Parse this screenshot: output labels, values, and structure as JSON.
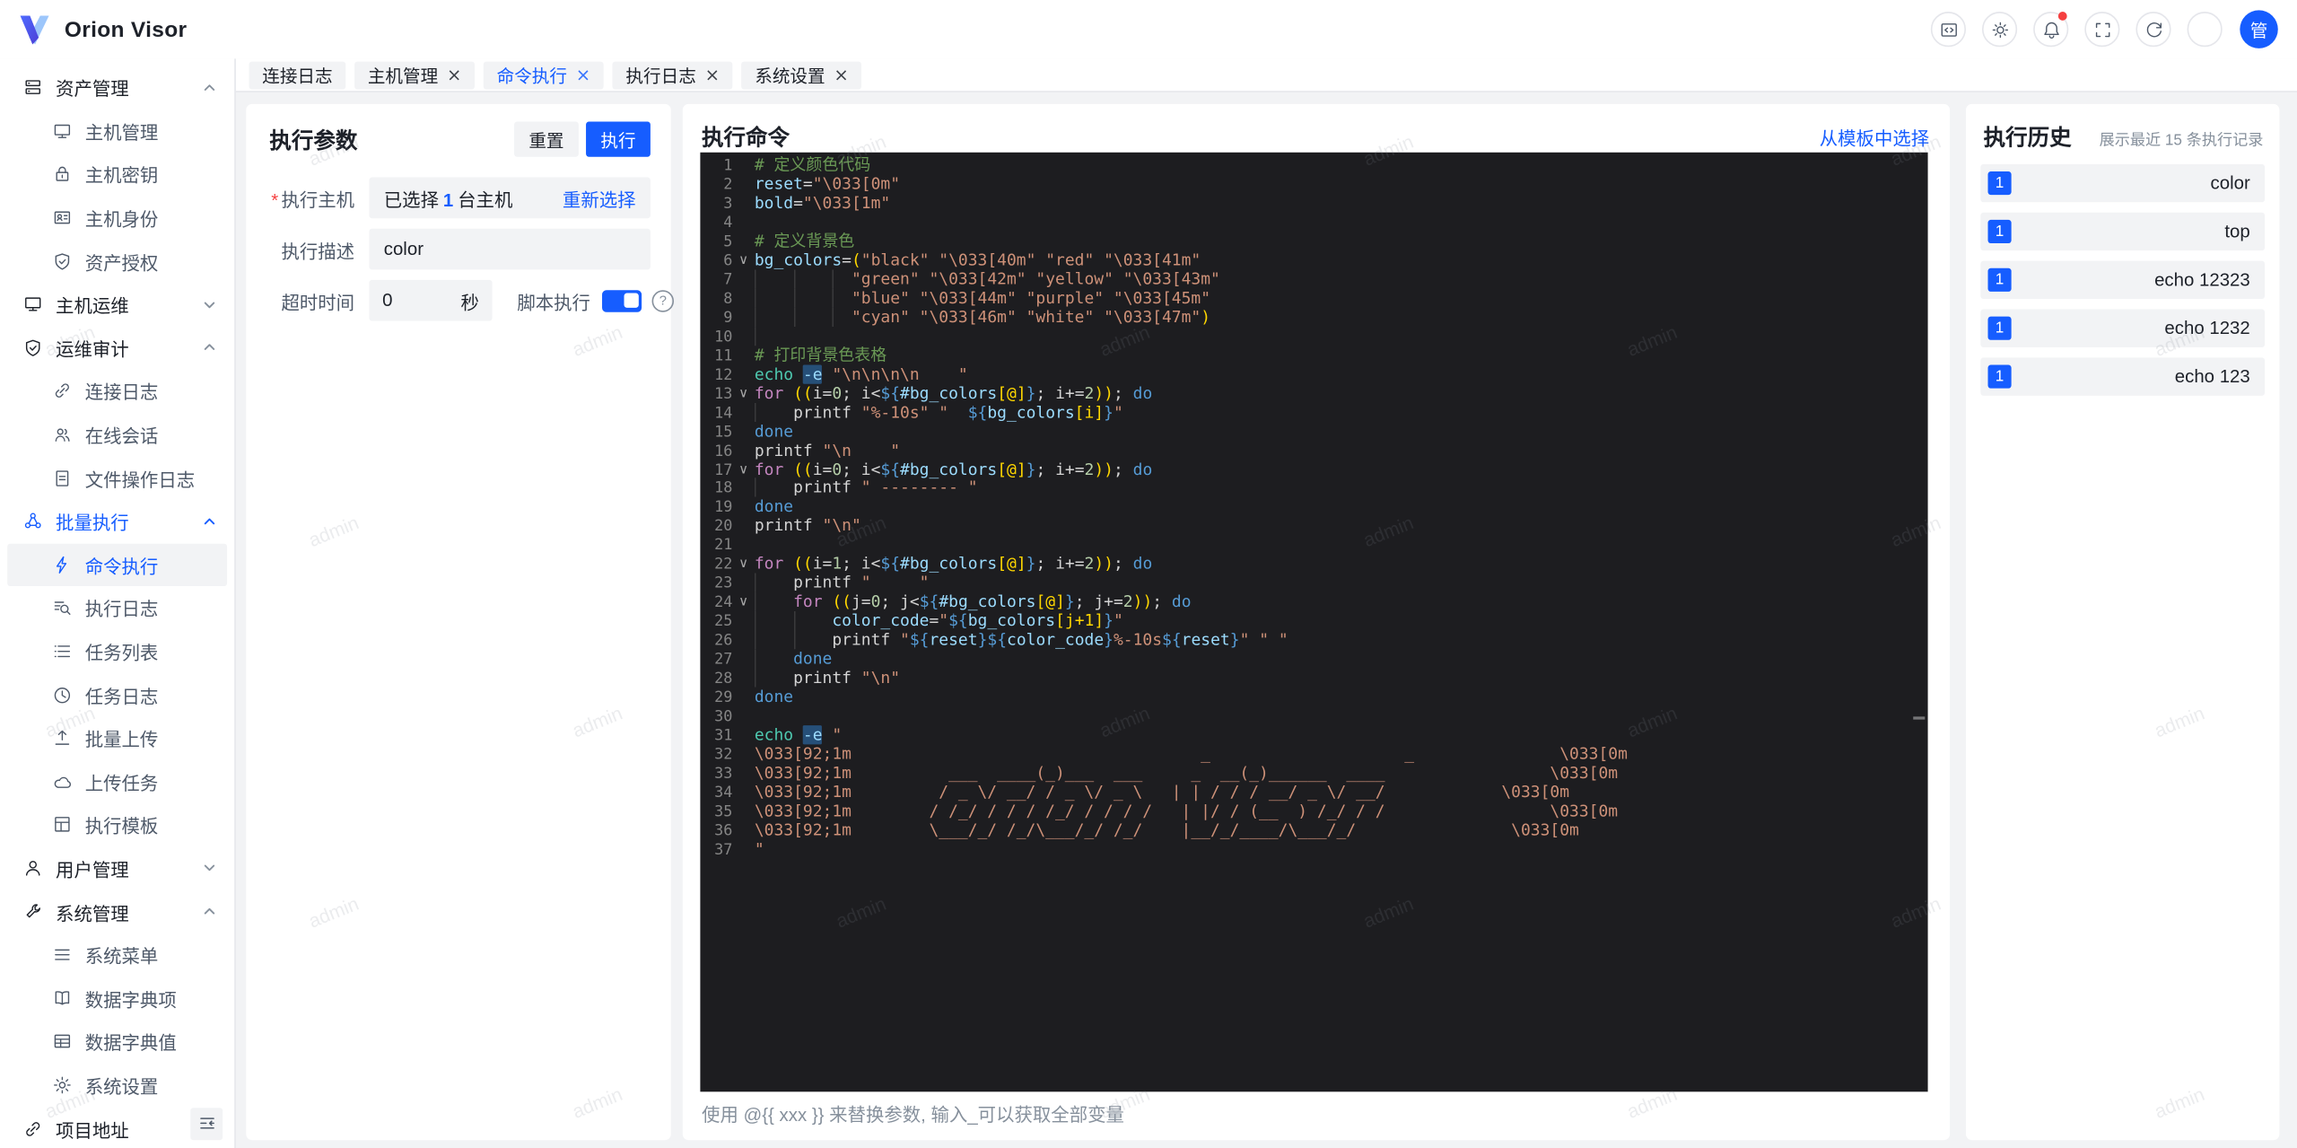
{
  "app": {
    "title": "Orion Visor",
    "avatar_text": "管"
  },
  "header": {
    "icons": [
      {
        "name": "code-window-icon"
      },
      {
        "name": "theme-icon"
      },
      {
        "name": "notification-icon",
        "dot": true
      },
      {
        "name": "fullscreen-icon"
      },
      {
        "name": "refresh-icon"
      },
      {
        "name": "settings-icon"
      }
    ]
  },
  "tabs": [
    {
      "label": "连接日志",
      "closable": false,
      "active": false
    },
    {
      "label": "主机管理",
      "closable": true,
      "active": false
    },
    {
      "label": "命令执行",
      "closable": true,
      "active": true
    },
    {
      "label": "执行日志",
      "closable": true,
      "active": false
    },
    {
      "label": "系统设置",
      "closable": true,
      "active": false
    }
  ],
  "sidebar": {
    "items": [
      {
        "label": "资产管理",
        "icon": "storage-icon",
        "lvl": 0,
        "chev": "up"
      },
      {
        "label": "主机管理",
        "icon": "desktop-icon",
        "lvl": 1
      },
      {
        "label": "主机密钥",
        "icon": "lock-icon",
        "lvl": 1
      },
      {
        "label": "主机身份",
        "icon": "idcard-icon",
        "lvl": 1
      },
      {
        "label": "资产授权",
        "icon": "safe-icon",
        "lvl": 1
      },
      {
        "label": "主机运维",
        "icon": "desktop-icon",
        "lvl": 0,
        "chev": "down"
      },
      {
        "label": "运维审计",
        "icon": "shield-icon",
        "lvl": 0,
        "chev": "up"
      },
      {
        "label": "连接日志",
        "icon": "link-icon",
        "lvl": 1
      },
      {
        "label": "在线会话",
        "icon": "users-icon",
        "lvl": 1
      },
      {
        "label": "文件操作日志",
        "icon": "file-icon",
        "lvl": 1
      },
      {
        "label": "批量执行",
        "icon": "cluster-icon",
        "lvl": 0,
        "chev": "up",
        "blue": true
      },
      {
        "label": "命令执行",
        "icon": "bolt-icon",
        "lvl": 1,
        "active": true
      },
      {
        "label": "执行日志",
        "icon": "search-list-icon",
        "lvl": 1
      },
      {
        "label": "任务列表",
        "icon": "list-icon",
        "lvl": 1
      },
      {
        "label": "任务日志",
        "icon": "clock-icon",
        "lvl": 1
      },
      {
        "label": "批量上传",
        "icon": "upload-icon",
        "lvl": 1
      },
      {
        "label": "上传任务",
        "icon": "cloud-icon",
        "lvl": 1
      },
      {
        "label": "执行模板",
        "icon": "template-icon",
        "lvl": 1
      },
      {
        "label": "用户管理",
        "icon": "user-icon",
        "lvl": 0,
        "chev": "down"
      },
      {
        "label": "系统管理",
        "icon": "wrench-icon",
        "lvl": 0,
        "chev": "up"
      },
      {
        "label": "系统菜单",
        "icon": "menu-icon",
        "lvl": 1
      },
      {
        "label": "数据字典项",
        "icon": "book-icon",
        "lvl": 1
      },
      {
        "label": "数据字典值",
        "icon": "table-icon",
        "lvl": 1
      },
      {
        "label": "系统设置",
        "icon": "gear-icon",
        "lvl": 1
      },
      {
        "label": "项目地址",
        "icon": "link-icon",
        "lvl": 0
      }
    ]
  },
  "params": {
    "title": "执行参数",
    "reset": "重置",
    "run": "执行",
    "host_label": "执行主机",
    "host_value_prefix": "已选择",
    "host_count": "1",
    "host_value_suffix": "台主机",
    "reselect": "重新选择",
    "desc_label": "执行描述",
    "desc_value": "color",
    "timeout_label": "超时时间",
    "timeout_value": "0",
    "timeout_unit": "秒",
    "script_label": "脚本执行",
    "script_on": true,
    "help": "?"
  },
  "command": {
    "title": "执行命令",
    "template_link": "从模板中选择",
    "hint": "使用 @{{ xxx }} 来替换参数, 输入_可以获取全部变量"
  },
  "history": {
    "title": "执行历史",
    "subtitle": "展示最近 15 条执行记录",
    "items": [
      {
        "badge": "1",
        "text": "color"
      },
      {
        "badge": "1",
        "text": "top"
      },
      {
        "badge": "1",
        "text": "echo 12323"
      },
      {
        "badge": "1",
        "text": "echo 1232"
      },
      {
        "badge": "1",
        "text": "echo 123"
      }
    ]
  },
  "watermark": {
    "text": "admin"
  },
  "colors": {
    "primary": "#165dff",
    "danger": "#f53f3f",
    "page_bg": "#f2f3f5",
    "border": "#e5e6eb",
    "text": "#1d2129",
    "text_secondary": "#4e5969",
    "text_tertiary": "#86909c",
    "editor_bg": "#1d1d20"
  },
  "editor": {
    "lines": [
      {
        "n": 1,
        "t": [
          [
            "cm",
            "# 定义颜色代码"
          ]
        ]
      },
      {
        "n": 2,
        "t": [
          [
            "vr",
            "reset"
          ],
          [
            "pl",
            "="
          ],
          [
            "st",
            "\"\\033[0m\""
          ]
        ]
      },
      {
        "n": 3,
        "t": [
          [
            "vr",
            "bold"
          ],
          [
            "pl",
            "="
          ],
          [
            "st",
            "\"\\033[1m\""
          ]
        ]
      },
      {
        "n": 4,
        "t": []
      },
      {
        "n": 5,
        "t": [
          [
            "cm",
            "# 定义背景色"
          ]
        ]
      },
      {
        "n": 6,
        "f": true,
        "t": [
          [
            "vr",
            "bg_colors"
          ],
          [
            "pl",
            "="
          ],
          [
            "br",
            "("
          ],
          [
            "st",
            "\"black\" \"\\033[40m\" \"red\" \"\\033[41m\""
          ]
        ]
      },
      {
        "n": 7,
        "t": [
          [
            "g",
            "    "
          ],
          [
            "g",
            "    "
          ],
          [
            "g",
            "  "
          ],
          [
            "st",
            "\"green\" \"\\033[42m\" \"yellow\" \"\\033[43m\""
          ]
        ]
      },
      {
        "n": 8,
        "t": [
          [
            "g",
            "    "
          ],
          [
            "g",
            "    "
          ],
          [
            "g",
            "  "
          ],
          [
            "st",
            "\"blue\" \"\\033[44m\" \"purple\" \"\\033[45m\""
          ]
        ]
      },
      {
        "n": 9,
        "t": [
          [
            "g",
            "    "
          ],
          [
            "g",
            "    "
          ],
          [
            "g",
            "  "
          ],
          [
            "st",
            "\"cyan\" \"\\033[46m\" \"white\" \"\\033[47m\""
          ],
          [
            "br",
            ")"
          ]
        ]
      },
      {
        "n": 10,
        "t": [
          [
            "g",
            "    "
          ]
        ]
      },
      {
        "n": 11,
        "t": [
          [
            "cm",
            "# 打印背景色表格"
          ]
        ]
      },
      {
        "n": 12,
        "t": [
          [
            "fn",
            "echo"
          ],
          [
            "pl",
            " "
          ],
          [
            "se",
            "-e"
          ],
          [
            "pl",
            " "
          ],
          [
            "st",
            "\"\\n\\n\\n\\n    \""
          ]
        ]
      },
      {
        "n": 13,
        "f": true,
        "t": [
          [
            "kw",
            "for"
          ],
          [
            "pl",
            " "
          ],
          [
            "br",
            "(("
          ],
          [
            "pl",
            "i="
          ],
          [
            "nm",
            "0"
          ],
          [
            "pl",
            "; i<"
          ],
          [
            "bl",
            "${"
          ],
          [
            "vr",
            "#bg_colors"
          ],
          [
            "br",
            "[@]"
          ],
          [
            "bl",
            "}"
          ],
          [
            "pl",
            "; i+="
          ],
          [
            "nm",
            "2"
          ],
          [
            "br",
            "))"
          ],
          [
            "pl",
            "; "
          ],
          [
            "ct",
            "do"
          ]
        ]
      },
      {
        "n": 14,
        "t": [
          [
            "g",
            "    "
          ],
          [
            "pl",
            "printf "
          ],
          [
            "st",
            "\"%-10s\""
          ],
          [
            "pl",
            " "
          ],
          [
            "st",
            "\"  "
          ],
          [
            "bl",
            "${"
          ],
          [
            "vr",
            "bg_colors"
          ],
          [
            "br",
            "[i]"
          ],
          [
            "bl",
            "}"
          ],
          [
            "st",
            "\""
          ]
        ]
      },
      {
        "n": 15,
        "t": [
          [
            "ct",
            "done"
          ]
        ]
      },
      {
        "n": 16,
        "t": [
          [
            "pl",
            "printf "
          ],
          [
            "st",
            "\"\\n    \""
          ]
        ]
      },
      {
        "n": 17,
        "f": true,
        "t": [
          [
            "kw",
            "for"
          ],
          [
            "pl",
            " "
          ],
          [
            "br",
            "(("
          ],
          [
            "pl",
            "i="
          ],
          [
            "nm",
            "0"
          ],
          [
            "pl",
            "; i<"
          ],
          [
            "bl",
            "${"
          ],
          [
            "vr",
            "#bg_colors"
          ],
          [
            "br",
            "[@]"
          ],
          [
            "bl",
            "}"
          ],
          [
            "pl",
            "; i+="
          ],
          [
            "nm",
            "2"
          ],
          [
            "br",
            "))"
          ],
          [
            "pl",
            "; "
          ],
          [
            "ct",
            "do"
          ]
        ]
      },
      {
        "n": 18,
        "t": [
          [
            "g",
            "    "
          ],
          [
            "pl",
            "printf "
          ],
          [
            "st",
            "\" -------- \""
          ]
        ]
      },
      {
        "n": 19,
        "t": [
          [
            "ct",
            "done"
          ]
        ]
      },
      {
        "n": 20,
        "t": [
          [
            "pl",
            "printf "
          ],
          [
            "st",
            "\"\\n\""
          ]
        ]
      },
      {
        "n": 21,
        "t": []
      },
      {
        "n": 22,
        "f": true,
        "t": [
          [
            "kw",
            "for"
          ],
          [
            "pl",
            " "
          ],
          [
            "br",
            "(("
          ],
          [
            "pl",
            "i="
          ],
          [
            "nm",
            "1"
          ],
          [
            "pl",
            "; i<"
          ],
          [
            "bl",
            "${"
          ],
          [
            "vr",
            "#bg_colors"
          ],
          [
            "br",
            "[@]"
          ],
          [
            "bl",
            "}"
          ],
          [
            "pl",
            "; i+="
          ],
          [
            "nm",
            "2"
          ],
          [
            "br",
            "))"
          ],
          [
            "pl",
            "; "
          ],
          [
            "ct",
            "do"
          ]
        ]
      },
      {
        "n": 23,
        "t": [
          [
            "g",
            "    "
          ],
          [
            "pl",
            "printf "
          ],
          [
            "st",
            "\"     \""
          ]
        ]
      },
      {
        "n": 24,
        "f": true,
        "t": [
          [
            "g",
            "    "
          ],
          [
            "kw",
            "for"
          ],
          [
            "pl",
            " "
          ],
          [
            "br",
            "(("
          ],
          [
            "pl",
            "j="
          ],
          [
            "nm",
            "0"
          ],
          [
            "pl",
            "; j<"
          ],
          [
            "bl",
            "${"
          ],
          [
            "vr",
            "#bg_colors"
          ],
          [
            "br",
            "[@]"
          ],
          [
            "bl",
            "}"
          ],
          [
            "pl",
            "; j+="
          ],
          [
            "nm",
            "2"
          ],
          [
            "br",
            "))"
          ],
          [
            "pl",
            "; "
          ],
          [
            "ct",
            "do"
          ]
        ]
      },
      {
        "n": 25,
        "t": [
          [
            "g",
            "    "
          ],
          [
            "g",
            "    "
          ],
          [
            "vr",
            "color_code"
          ],
          [
            "pl",
            "="
          ],
          [
            "st",
            "\""
          ],
          [
            "bl",
            "${"
          ],
          [
            "vr",
            "bg_colors"
          ],
          [
            "br",
            "[j+1]"
          ],
          [
            "bl",
            "}"
          ],
          [
            "st",
            "\""
          ]
        ]
      },
      {
        "n": 26,
        "t": [
          [
            "g",
            "    "
          ],
          [
            "g",
            "    "
          ],
          [
            "pl",
            "printf "
          ],
          [
            "st",
            "\""
          ],
          [
            "bl",
            "${"
          ],
          [
            "vr",
            "reset"
          ],
          [
            "bl",
            "}"
          ],
          [
            "bl",
            "${"
          ],
          [
            "vr",
            "color_code"
          ],
          [
            "bl",
            "}"
          ],
          [
            "st",
            "%-10s"
          ],
          [
            "bl",
            "${"
          ],
          [
            "vr",
            "reset"
          ],
          [
            "bl",
            "}"
          ],
          [
            "st",
            "\""
          ],
          [
            "pl",
            " "
          ],
          [
            "st",
            "\" \""
          ]
        ]
      },
      {
        "n": 27,
        "t": [
          [
            "g",
            "    "
          ],
          [
            "ct",
            "done"
          ]
        ]
      },
      {
        "n": 28,
        "t": [
          [
            "g",
            "    "
          ],
          [
            "pl",
            "printf "
          ],
          [
            "st",
            "\"\\n\""
          ]
        ]
      },
      {
        "n": 29,
        "t": [
          [
            "ct",
            "done"
          ]
        ]
      },
      {
        "n": 30,
        "t": []
      },
      {
        "n": 31,
        "t": [
          [
            "fn",
            "echo"
          ],
          [
            "pl",
            " "
          ],
          [
            "se",
            "-e"
          ],
          [
            "pl",
            " "
          ],
          [
            "st",
            "\""
          ]
        ]
      },
      {
        "n": 32,
        "t": [
          [
            "st",
            "\\033[92;1m                                    _                    _               \\033[0m"
          ]
        ]
      },
      {
        "n": 33,
        "t": [
          [
            "st",
            "\\033[92;1m          ___  ____(_)___  ___     _  __(_)______  ____                 \\033[0m"
          ]
        ]
      },
      {
        "n": 34,
        "t": [
          [
            "st",
            "\\033[92;1m         / _ \\/ __/ / _ \\/ _ \\   | | / / / __/ _ \\/ __/            \\033[0m"
          ]
        ]
      },
      {
        "n": 35,
        "t": [
          [
            "st",
            "\\033[92;1m        / /_/ / / / /_/ / / / /   | |/ / (__  ) /_/ / /                 \\033[0m"
          ]
        ]
      },
      {
        "n": 36,
        "t": [
          [
            "st",
            "\\033[92;1m        \\___/_/ /_/\\___/_/ /_/    |__/_/____/\\___/_/                \\033[0m"
          ]
        ]
      },
      {
        "n": 37,
        "t": [
          [
            "st",
            "\""
          ]
        ]
      }
    ]
  }
}
